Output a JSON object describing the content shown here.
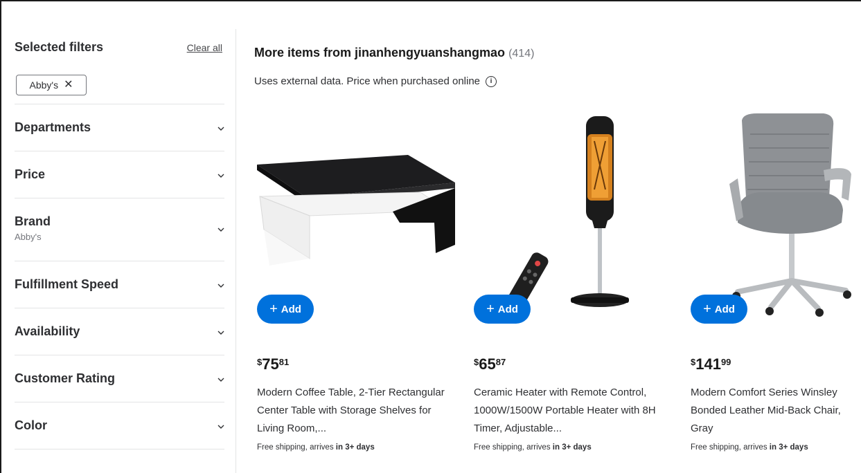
{
  "sidebar": {
    "selected_title": "Selected filters",
    "clear_all": "Clear all",
    "chip_label": "Abby's",
    "chip_close": "✕",
    "facets": [
      {
        "label": "Departments",
        "sub": ""
      },
      {
        "label": "Price",
        "sub": ""
      },
      {
        "label": "Brand",
        "sub": "Abby's"
      },
      {
        "label": "Fulfillment Speed",
        "sub": ""
      },
      {
        "label": "Availability",
        "sub": ""
      },
      {
        "label": "Customer Rating",
        "sub": ""
      },
      {
        "label": "Color",
        "sub": ""
      }
    ]
  },
  "main": {
    "heading": "More items from jinanhengyuanshangmao",
    "count": "(414)",
    "note": "Uses external data. Price when purchased online",
    "info_glyph": "i",
    "add_label": "Add",
    "add_plus": "+",
    "products": [
      {
        "currency": "$",
        "dollars": "75",
        "cents": "81",
        "title": "Modern Coffee Table, 2-Tier Rectangular Center Table with Storage Shelves for Living Room,...",
        "ship_prefix": "Free shipping, arrives",
        "ship_bold": "in 3+ days",
        "icon": "coffee-table-image"
      },
      {
        "currency": "$",
        "dollars": "65",
        "cents": "87",
        "title": "Ceramic Heater with Remote Control, 1000W/1500W Portable Heater with 8H Timer, Adjustable...",
        "ship_prefix": "Free shipping, arrives",
        "ship_bold": "in 3+ days",
        "icon": "heater-image"
      },
      {
        "currency": "$",
        "dollars": "141",
        "cents": "99",
        "title": "Modern Comfort Series Winsley Bonded Leather Mid-Back Chair, Gray",
        "ship_prefix": "Free shipping, arrives",
        "ship_bold": "in 3+ days",
        "icon": "office-chair-image"
      }
    ]
  },
  "colors": {
    "accent": "#0071dc",
    "text": "#2e2f32",
    "muted": "#74767c",
    "divider": "#e3e4e5"
  }
}
